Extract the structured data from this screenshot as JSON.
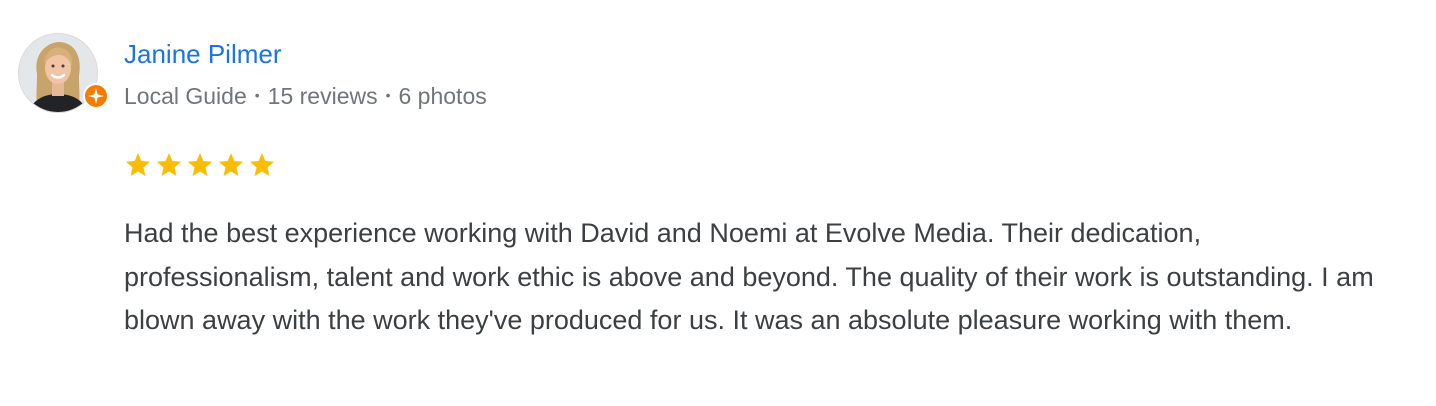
{
  "review": {
    "author": {
      "name": "Janine Pilmer",
      "badge": "Local Guide",
      "separator": "•",
      "review_count": "15 reviews",
      "photo_count": "6 photos",
      "badge_icon": "local-guide-star-icon",
      "badge_color": "#f57c00"
    },
    "rating": {
      "stars": 5,
      "max_stars": 5,
      "star_color": "#fbbc04"
    },
    "text": "Had the best experience working with David and Noemi at Evolve Media. Their dedication, professionalism, talent and work ethic is above and beyond. The quality of their work is outstanding. I am blown away with the work they've produced for us. It was an absolute pleasure working with them."
  },
  "colors": {
    "name_link": "#1a73e8",
    "meta_text": "#70757a",
    "body_text": "#3c4043"
  }
}
